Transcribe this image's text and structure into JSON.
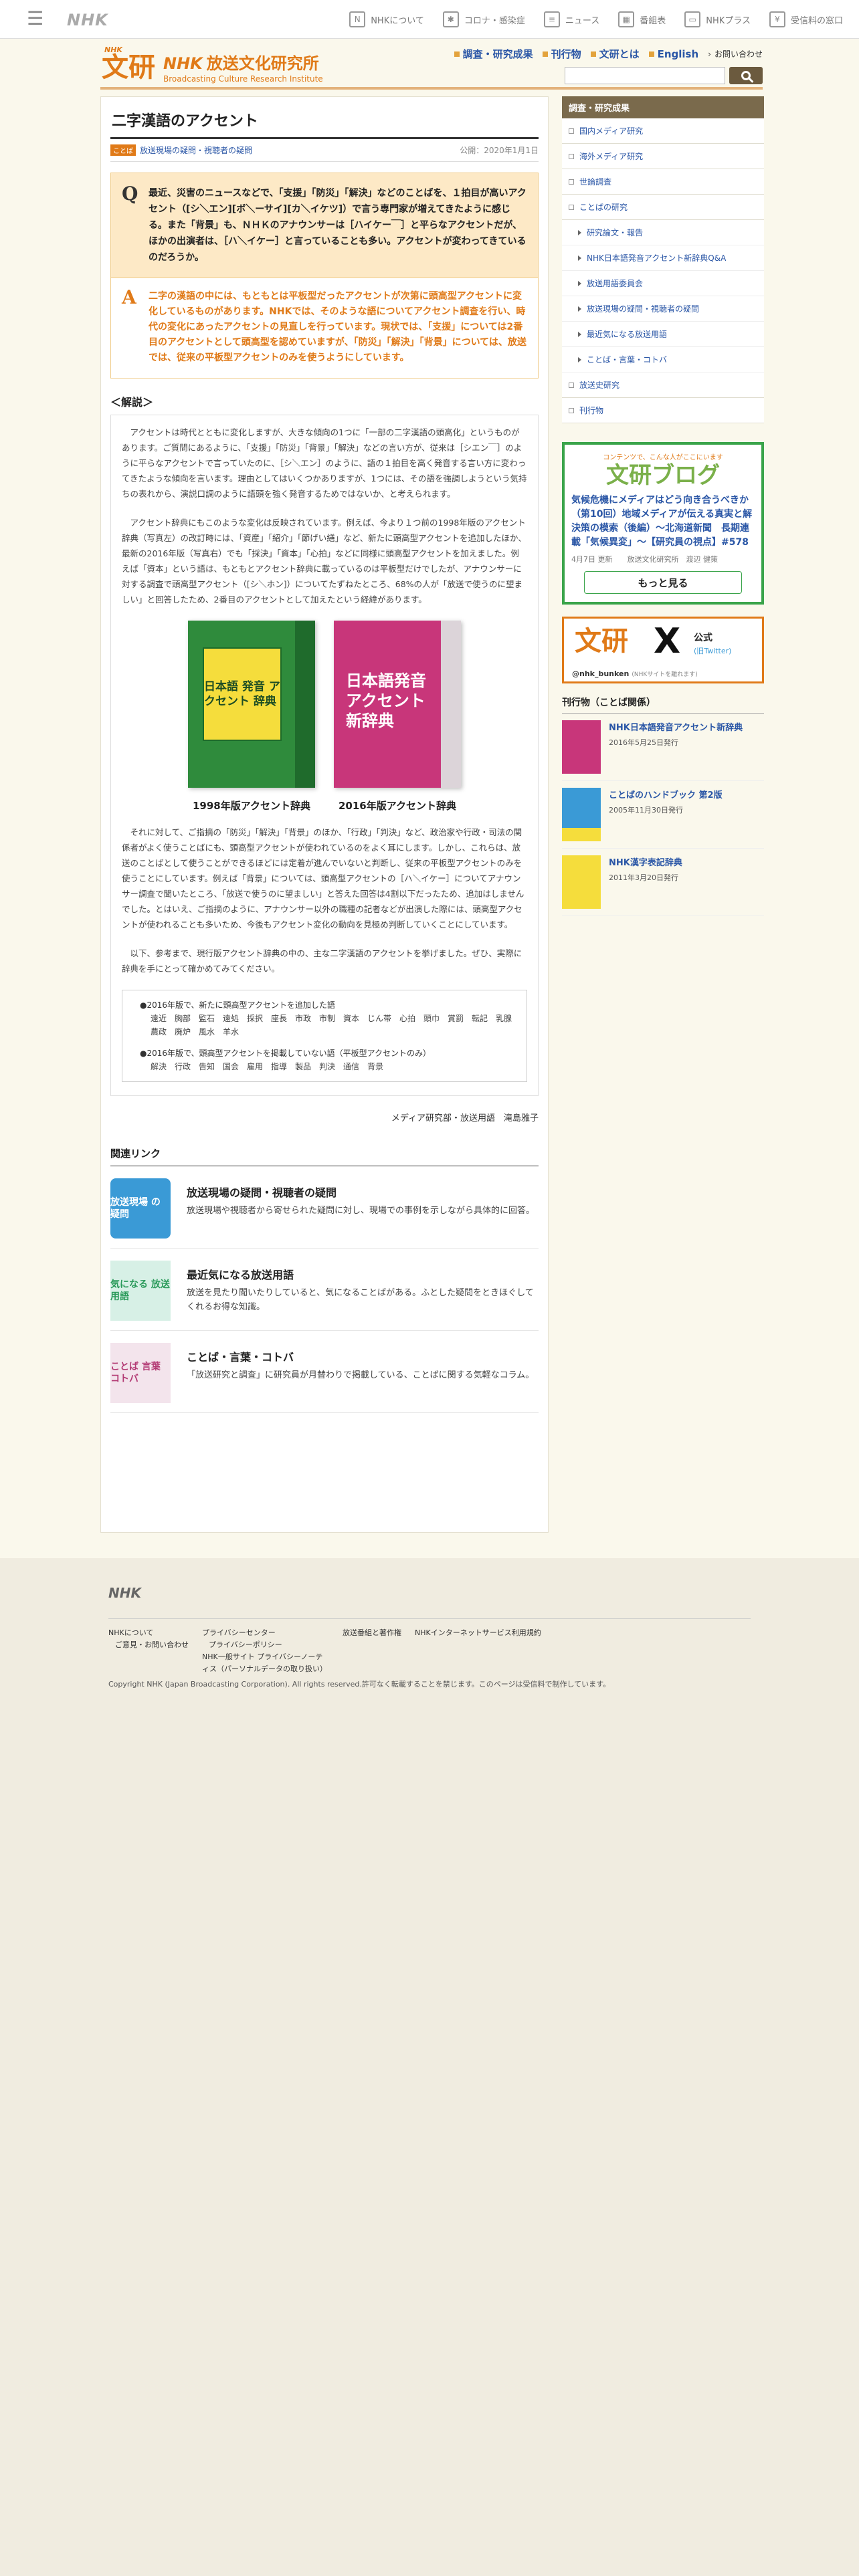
{
  "topbar": {
    "menu_icon": "hamburger-menu-icon",
    "logo": "NHK",
    "links": [
      {
        "label": "NHKについて",
        "icon": "nhk-icon"
      },
      {
        "label": "コロナ・感染症",
        "icon": "virus-icon"
      },
      {
        "label": "ニュース",
        "icon": "news-icon"
      },
      {
        "label": "番組表",
        "icon": "grid-icon"
      },
      {
        "label": "NHKプラス",
        "icon": "tv-icon"
      },
      {
        "label": "受信料の窓口",
        "icon": "receipt-icon"
      }
    ]
  },
  "header": {
    "logo_small": "NHK 放送文化研究所",
    "logo_kanji": "文研",
    "logo_nhk": "NHK",
    "logo_jp": "放送文化研究所",
    "logo_en": "Broadcasting Culture Research Institute",
    "nav": [
      "調査・研究成果",
      "刊行物",
      "文研とは",
      "English"
    ],
    "contact": "お問い合わせ",
    "search_placeholder": ""
  },
  "article": {
    "title": "二字漢語のアクセント",
    "category_tag": "ことば",
    "category": "放送現場の疑問・視聴者の疑問",
    "date": "公開：2020年1月1日",
    "q_mark": "Q",
    "question": "最近、災害のニュースなどで、「支援」「防災」「解決」などのことばを、１拍目が高いアクセント（[シ＼エン][ボ＼ーサイ][カ＼イケツ]）で言う専門家が増えてきたように感じる。また「背景」も、ＮＨＫのアナウンサーは［ハイケー￣］と平らなアクセントだが、ほかの出演者は、［ハ＼イケー］と言っていることも多い。アクセントが変わってきているのだろうか。",
    "a_mark": "A",
    "answer": "二字の漢語の中には、もともとは平板型だったアクセントが次第に頭高型アクセントに変化しているものがあります。NHKでは、そのような語についてアクセント調査を行い、時代の変化にあったアクセントの見直しを行っています。現状では、「支援」については2番目のアクセントとして頭高型を認めていますが、「防災」「解決」「背景」については、放送では、従来の平板型アクセントのみを使うようにしています。",
    "explain_title": "＜解説＞",
    "para1": "アクセントは時代とともに変化しますが、大きな傾向の1つに「一部の二字漢語の頭高化」というものがあります。ご質問にあるように、「支援」「防災」「背景」「解決」などの言い方が、従来は［シエン￣］のように平らなアクセントで言っていたのに、［シ＼エン］のように、語の１拍目を高く発音する言い方に変わってきたような傾向を言います。理由としてはいくつかありますが、1つには、その語を強調しようという気持ちの表れから、演説口調のように語頭を強く発音するためではないか、と考えられます。",
    "para2": "アクセント辞典にもこのような変化は反映されています。例えば、今より１つ前の1998年版のアクセント辞典（写真左）の改訂時には、「資産」「紹介」「節げい繕」など、新たに頭高型アクセントを追加したほか、最新の2016年版（写真右）でも「採決」「資本」「心拍」などに同様に頭高型アクセントを加えました。例えば「資本」という語は、もともとアクセント辞典に載っているのは平板型だけでしたが、アナウンサーに対する調査で頭高型アクセント（[シ＼ホン]）についてたずねたところ、68%の人が「放送で使うのに望ましい」と回答したため、2番目のアクセントとして加えたという経緯があります。",
    "books": [
      {
        "caption": "1998年版アクセント辞典",
        "cover_title": "日本語 発音 アクセント 辞典"
      },
      {
        "caption": "2016年版アクセント辞典",
        "cover_title": "日本語発音 アクセント 新辞典"
      }
    ],
    "para3": "それに対して、ご指摘の「防災」「解決」「背景」のほか、「行政」「判決」など、政治家や行政・司法の関係者がよく使うことばにも、頭高型アクセントが使われているのをよく耳にします。しかし、これらは、放送のことばとして使うことができるほどには定着が進んでいないと判断し、従来の平板型アクセントのみを使うことにしています。例えば「背景」については、頭高型アクセントの［ハ＼イケー］についてアナウンサー調査で聞いたところ、「放送で使うのに望ましい」と答えた回答は4割以下だったため、追加はしませんでした。とはいえ、ご指摘のように、アナウンサー以外の職種の記者などが出演した際には、頭高型アクセントが使われることも多いため、今後もアクセント変化の動向を見極め判断していくことにしています。",
    "para4": "以下、参考まで、現行版アクセント辞典の中の、主な二字漢語のアクセントを挙げました。ぜひ、実際に辞典を手にとって確かめてみてください。",
    "ex1_head": "●2016年版で、新たに頭高型アクセントを追加した語",
    "ex1_words": "遠近　胸部　監石　遠処　採択　座長　市政　市制　資本　じん帯　心拍　頭巾　賞罰　転記　乳腺　農政　廃炉　風水　羊水",
    "ex2_head": "●2016年版で、頭高型アクセントを掲載していない語（平板型アクセントのみ）",
    "ex2_words": "解決　行政　告知　国会　雇用　指導　製品　判決　通信　背景",
    "byline": "メディア研究部・放送用語　滝島雅子",
    "related_title": "関連リンク",
    "related": [
      {
        "thumb": "放送現場 の 疑問",
        "title": "放送現場の疑問・視聴者の疑問",
        "desc": "放送現場や視聴者から寄せられた疑問に対し、現場での事例を示しながら具体的に回答。"
      },
      {
        "thumb": "気になる 放送 用語",
        "title": "最近気になる放送用語",
        "desc": "放送を見たり聞いたりしていると、気になることばがある。ふとした疑問をときほぐしてくれるお得な知識。"
      },
      {
        "thumb": "ことば 言葉 コトバ",
        "title": "ことば・言葉・コトバ",
        "desc": "「放送研究と調査」に研究員が月替わりで掲載している、ことばに関する気軽なコラム。"
      }
    ]
  },
  "sidebar": {
    "head": "調査・研究成果",
    "items": [
      "国内メディア研究",
      "海外メディア研究",
      "世論調査",
      "ことばの研究"
    ],
    "subitems": [
      "研究論文・報告",
      "NHK日本語発音アクセント新辞典Q&A",
      "放送用語委員会",
      "放送現場の疑問・視聴者の疑問",
      "最近気になる放送用語",
      "ことば・言葉・コトバ"
    ],
    "items2": [
      "放送史研究",
      "刊行物"
    ],
    "blog": {
      "sponsor": "コンテンツで、こんな人がここにいます",
      "title": "文研ブログ",
      "post": "気候危機にメディアはどう向き合うべきか（第10回）地域メディアが伝える真実と解決策の模索（後編）～北海道新聞　長期連載「気候異変」～【研究員の視点】#578",
      "meta": "4月7日 更新　　放送文化研究所　渡辺 健策",
      "more": "もっと見る"
    },
    "x": {
      "logo": "文研",
      "mark": "X",
      "official": "公式",
      "old": "(旧Twitter)",
      "handle": "@nhk_bunken",
      "handle_note": "(NHKサイトを離れます)"
    },
    "pubs_title": "刊行物（ことば関係）",
    "pubs": [
      {
        "title": "NHK日本語発音アクセント新辞典",
        "date": "2016年5月25日発行"
      },
      {
        "title": "ことばのハンドブック 第2版",
        "date": "2005年11月30日発行"
      },
      {
        "title": "NHK漢字表記辞典",
        "date": "2011年3月20日発行"
      }
    ]
  },
  "footer": {
    "logo": "NHK",
    "col1": [
      "NHKについて",
      "ご意見・お問い合わせ"
    ],
    "col2": [
      "プライバシーセンター",
      "プライバシーポリシー",
      "NHK一般サイト プライバシーノーティス（パーソナルデータの取り扱い）"
    ],
    "col3": [
      "放送番組と著作権"
    ],
    "col4": [
      "NHKインターネットサービス利用規約"
    ],
    "copyright": "Copyright NHK (Japan Broadcasting Corporation). All rights reserved.許可なく転載することを禁じます。このページは受信料で制作しています。"
  }
}
